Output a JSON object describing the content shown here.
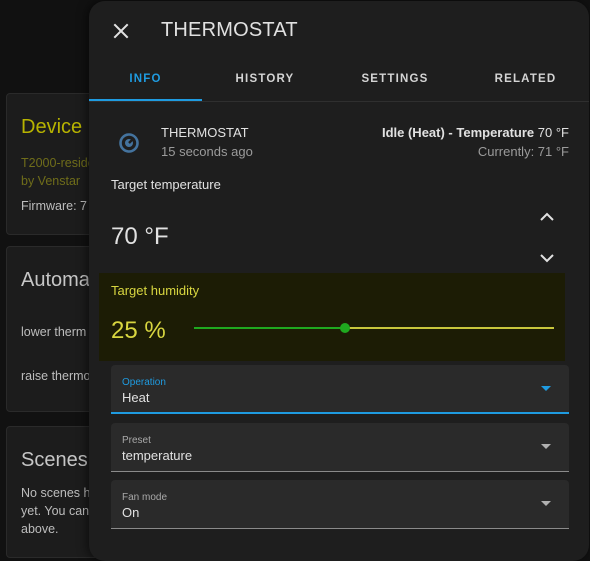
{
  "background": {
    "device_card": {
      "title": "Device",
      "model_line": "T2000-reside",
      "manufacturer_line": "by Venstar",
      "firmware_line": "Firmware: 7"
    },
    "automations_card": {
      "title": "Automa",
      "items": [
        "lower therm",
        "raise thermo"
      ]
    },
    "scenes_card": {
      "title": "Scenes",
      "lines": [
        "No scenes h",
        "yet. You can",
        "above."
      ]
    }
  },
  "dialog": {
    "title": "THERMOSTAT",
    "close_icon": "close-icon",
    "tabs": [
      {
        "label": "INFO",
        "active": true
      },
      {
        "label": "HISTORY",
        "active": false
      },
      {
        "label": "SETTINGS",
        "active": false
      },
      {
        "label": "RELATED",
        "active": false
      }
    ],
    "entity": {
      "icon": "thermostat-icon",
      "name": "THERMOSTAT",
      "last_changed": "15 seconds ago",
      "state_bold": "Idle (Heat) - Temperature",
      "state_value": "70 °F",
      "current": "Currently: 71 °F"
    },
    "target_temperature": {
      "label": "Target temperature",
      "value": "70 °F",
      "up_icon": "chevron-up-icon",
      "down_icon": "chevron-down-icon"
    },
    "target_humidity": {
      "label": "Target humidity",
      "value": "25 %",
      "slider_fraction": 0.42
    },
    "selects": [
      {
        "label": "Operation",
        "value": "Heat",
        "focused": true
      },
      {
        "label": "Preset",
        "value": "temperature",
        "focused": false
      },
      {
        "label": "Fan mode",
        "value": "On",
        "focused": false
      }
    ]
  },
  "colors": {
    "accent": "#1f9be0",
    "humidity_text": "#d8d640",
    "slider_active": "#1fa81f",
    "slider_inactive": "#c8c63c",
    "background": "#111111",
    "dialog": "#1e1e1e"
  }
}
